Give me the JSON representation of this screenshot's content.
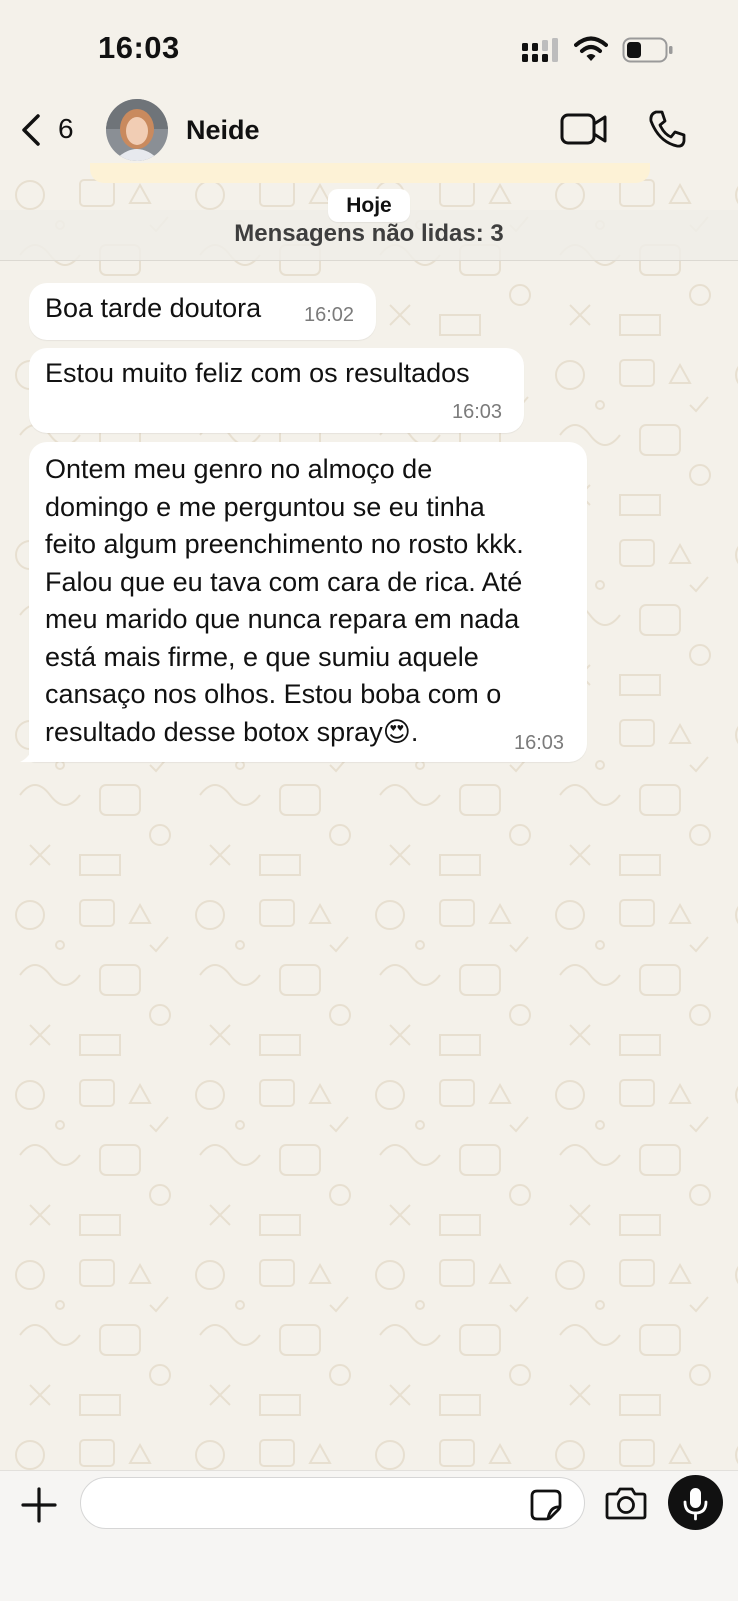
{
  "status_bar": {
    "time": "16:03",
    "battery_level": 0.3
  },
  "header": {
    "back_count": "6",
    "contact_name": "Neide"
  },
  "chat": {
    "date_label": "Hoje",
    "unread_label": "Mensagens não lidas: 3",
    "messages": [
      {
        "text": "Boa tarde doutora",
        "time": "16:02"
      },
      {
        "text": "Estou muito feliz com os resultados",
        "time": "16:03"
      },
      {
        "lines": [
          "Ontem meu genro no almoço de",
          "domingo e me perguntou se eu tinha",
          "feito algum preenchimento no rosto kkk.",
          "Falou que eu tava com cara de rica. Até",
          "meu marido que nunca repara em nada",
          "está mais firme, e que sumiu aquele",
          "cansaço nos olhos. Estou boba com o",
          "resultado desse botox spray😍."
        ],
        "time": "16:03"
      }
    ]
  },
  "input_bar": {
    "value": "",
    "placeholder": ""
  },
  "colors": {
    "bubble": "#ffffff",
    "wallpaper": "#f4f1ea",
    "mic_button": "#111111"
  },
  "icons": [
    "back-chevron-icon",
    "video-call-icon",
    "phone-call-icon",
    "plus-icon",
    "sticker-icon",
    "camera-icon",
    "microphone-icon"
  ]
}
